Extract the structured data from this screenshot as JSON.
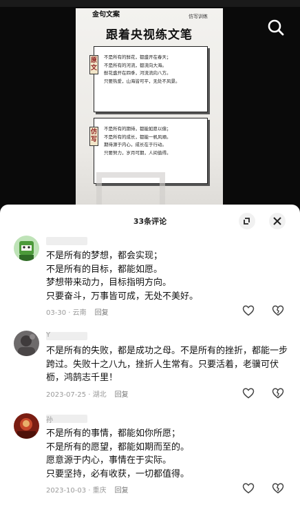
{
  "video": {
    "poster": {
      "brand": "金句文案",
      "tag": "仿写训练",
      "title": "跟着央视练文笔",
      "original_label": "原文",
      "original_lines": [
        "不是所有的鲜花，都盛开在春天；",
        "不是所有的河流，都流向大海。",
        "鲜花盛开在四季，河流流向八方。",
        "只要热爱，山海皆可平，无处不风景。"
      ],
      "imitation_label": "仿写",
      "imitation_lines": [
        "不是所有的期待，都能如愿以偿；",
        "不是所有的成长，都能一帆风顺。",
        "期待源于内心，成长在于行动。",
        "只要努力，岁月可期，人间值得。"
      ]
    }
  },
  "sheet": {
    "title": "33条评论"
  },
  "comments": [
    {
      "name": "",
      "lines": [
        "不是所有的梦想，都会实现；",
        "不是所有的目标，都能如愿。",
        "梦想带来动力，目标指明方向。",
        "只要奋斗，万事皆可成，无处不美好。"
      ],
      "date": "03-30",
      "location": "云南",
      "reply": "回复"
    },
    {
      "name": "Y",
      "text": "不是所有的失败，都是成功之母。不是所有的挫折，都能一步跨过。失败十之八九，挫折人生常有。只要活着，老骥可伏枥，鸿鹄志千里！",
      "date": "2023-07-25",
      "location": "湖北",
      "reply": "回复"
    },
    {
      "name": "孙",
      "lines": [
        "不是所有的事情，都能如你所愿；",
        "不是所有的愿望，都能如期而至的。",
        "愿意源于内心，事情在于实际。",
        "只要坚持，必有收获，一切都值得。"
      ],
      "date": "2023-10-03",
      "location": "重庆",
      "reply": "回复"
    }
  ],
  "colors": {
    "accent": "#8a1a1a",
    "meta": "#999999"
  },
  "icons": {
    "search": "search-icon",
    "expand": "expand-icon",
    "close": "close-icon",
    "like": "heart-icon",
    "dislike": "broken-heart-icon"
  }
}
